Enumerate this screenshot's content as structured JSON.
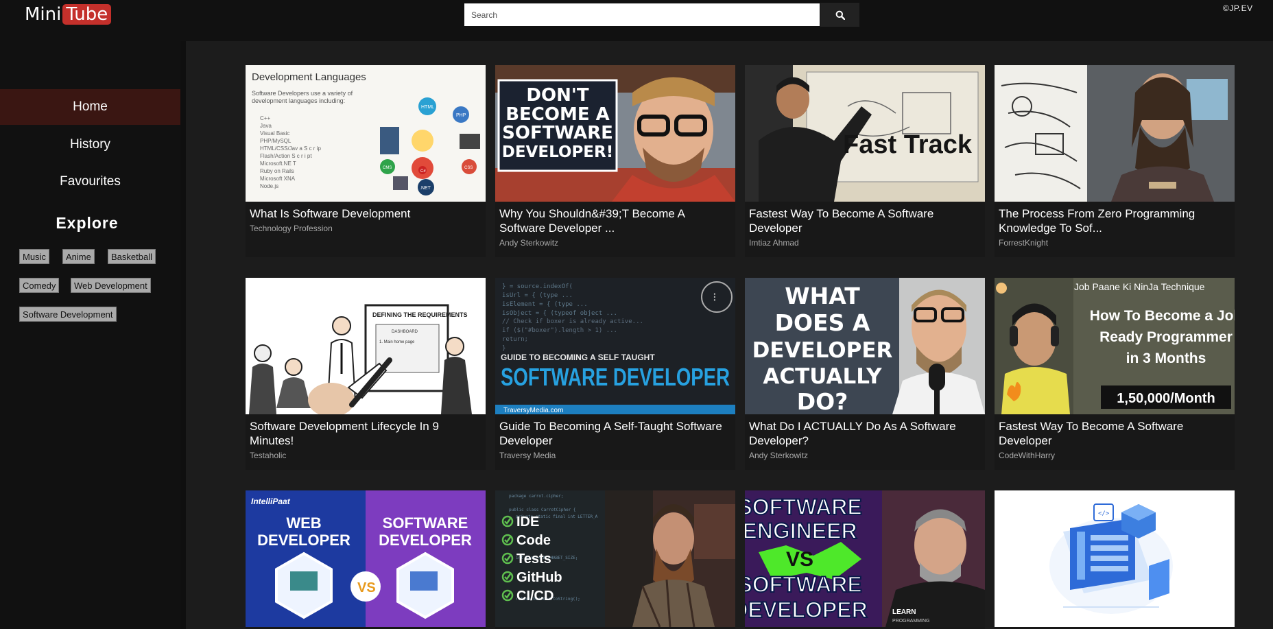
{
  "header": {
    "logo_mini": "Mini",
    "logo_tube": "Tube",
    "search_placeholder": "Search",
    "search_icon": "search-icon",
    "copyright": "©JP.EV"
  },
  "sidebar": {
    "nav": [
      {
        "label": "Home",
        "active": true
      },
      {
        "label": "History",
        "active": false
      },
      {
        "label": "Favourites",
        "active": false
      }
    ],
    "explore_heading": "Explore",
    "tags": [
      "Music",
      "Anime",
      "Basketball",
      "Comedy",
      "Web Development",
      "Software Development"
    ]
  },
  "videos": [
    {
      "title": "What Is Software Development",
      "channel": "Technology Profession",
      "thumb_text": [
        "Development Languages",
        "Software Developers use a variety of",
        "development languages including:",
        "C++",
        "Java",
        "Visual Basic",
        "PHP/MySQL",
        "HTML/CSS/Jav a S c r ip",
        "Flash/Action S c r i pt",
        "Microsoft.NE T",
        "Ruby on Rails",
        "Microsoft XNA",
        "Node.js",
        "HTML",
        "PHP",
        "CMS",
        "C#",
        "CSS",
        ".NET"
      ]
    },
    {
      "title": "Why You Shouldn&#39;T Become A Software Developer ...",
      "channel": "Andy Sterkowitz",
      "thumb_text": [
        "DON'T",
        "BECOME A",
        "SOFTWARE",
        "DEVELOPER!"
      ]
    },
    {
      "title": "Fastest Way To Become A Software Developer",
      "channel": "Imtiaz Ahmad",
      "thumb_text": [
        "Fast Track"
      ]
    },
    {
      "title": "The Process From Zero Programming Knowledge To Sof...",
      "channel": "ForrestKnight",
      "thumb_text": []
    },
    {
      "title": "Software Development Lifecycle In 9 Minutes!",
      "channel": "Testaholic",
      "thumb_text": [
        "DEFINING THE REQUIREMENTS",
        "DASHBOARD",
        "1. Main home page"
      ]
    },
    {
      "title": "Guide To Becoming A Self-Taught Software Developer",
      "channel": "Traversy Media",
      "thumb_text": [
        "GUIDE TO BECOMING A SELF TAUGHT",
        "SOFTWARE DEVELOPER",
        "TraversyMedia.com"
      ]
    },
    {
      "title": "What Do I ACTUALLY Do As A Software Developer?",
      "channel": "Andy Sterkowitz",
      "thumb_text": [
        "WHAT",
        "DOES A",
        "DEVELOPER",
        "ACTUALLY",
        "DO?"
      ]
    },
    {
      "title": "Fastest Way To Become A Software Developer",
      "channel": "CodeWithHarry",
      "thumb_text": [
        "Job Paane Ki NinJa Technique",
        "How To Become a Job",
        "Ready Programmer",
        "in 3 Months",
        "1,50,000/Month"
      ]
    },
    {
      "title": "",
      "channel": "",
      "thumb_text": [
        "IntelliPaat",
        "WEB",
        "DEVELOPER",
        "SOFTWARE",
        "DEVELOPER",
        "VS"
      ]
    },
    {
      "title": "",
      "channel": "",
      "thumb_text": [
        "IDE",
        "Code",
        "Tests",
        "GitHub",
        "CI/CD"
      ]
    },
    {
      "title": "",
      "channel": "",
      "thumb_text": [
        "SOFTWARE",
        "ENGINEER",
        "VS",
        "SOFTWARE",
        "DEVELOPER",
        "LEARN",
        "PROGRAMMING"
      ]
    },
    {
      "title": "",
      "channel": "",
      "thumb_text": []
    }
  ],
  "colors": {
    "accent": "#c4302b",
    "active_nav": "#3a1612",
    "bg": "#0f0f0f",
    "main_bg": "#1c1c1c"
  }
}
